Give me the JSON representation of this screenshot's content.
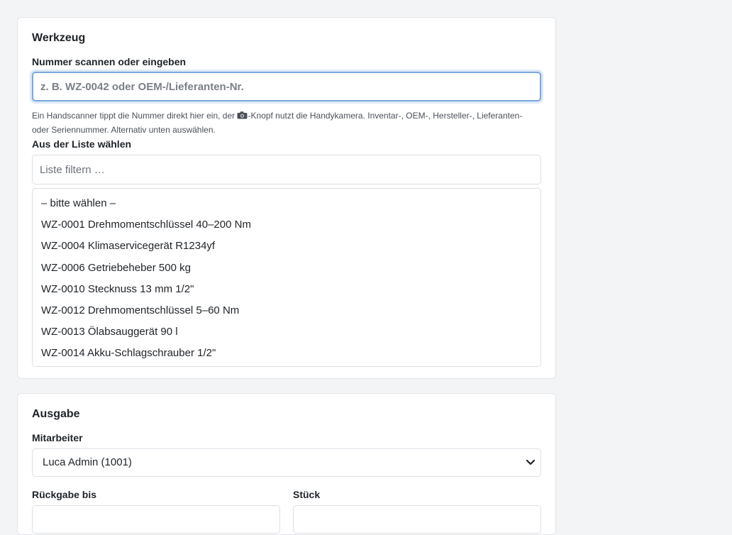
{
  "tool_card": {
    "title": "Werkzeug",
    "scan_label": "Nummer scannen oder eingeben",
    "scan_placeholder": "z. B. WZ-0042 oder OEM-/Lieferanten-Nr.",
    "help_before": "Ein Handscanner tippt die Nummer direkt hier ein, der ",
    "help_icon": "camera-icon",
    "help_after": "-Knopf nutzt die Handykamera. Inventar-, OEM-, Hersteller-, Lieferanten- oder Seriennummer. Alternativ unten auswählen.",
    "list_label": "Aus der Liste wählen",
    "filter_placeholder": "Liste filtern …",
    "options": [
      "– bitte wählen –",
      "WZ-0001 Drehmomentschlüssel 40–200 Nm",
      "WZ-0004 Klimaservicegerät R1234yf",
      "WZ-0006 Getriebeheber 500 kg",
      "WZ-0010 Stecknuss 13 mm 1/2\"",
      "WZ-0012 Drehmomentschlüssel 5–60 Nm",
      "WZ-0013 Ölabsauggerät 90 l",
      "WZ-0014 Akku-Schlagschrauber 1/2\""
    ]
  },
  "output_card": {
    "title": "Ausgabe",
    "employee_label": "Mitarbeiter",
    "employee_value": "Luca Admin (1001)",
    "return_label": "Rückgabe bis",
    "qty_label": "Stück"
  }
}
